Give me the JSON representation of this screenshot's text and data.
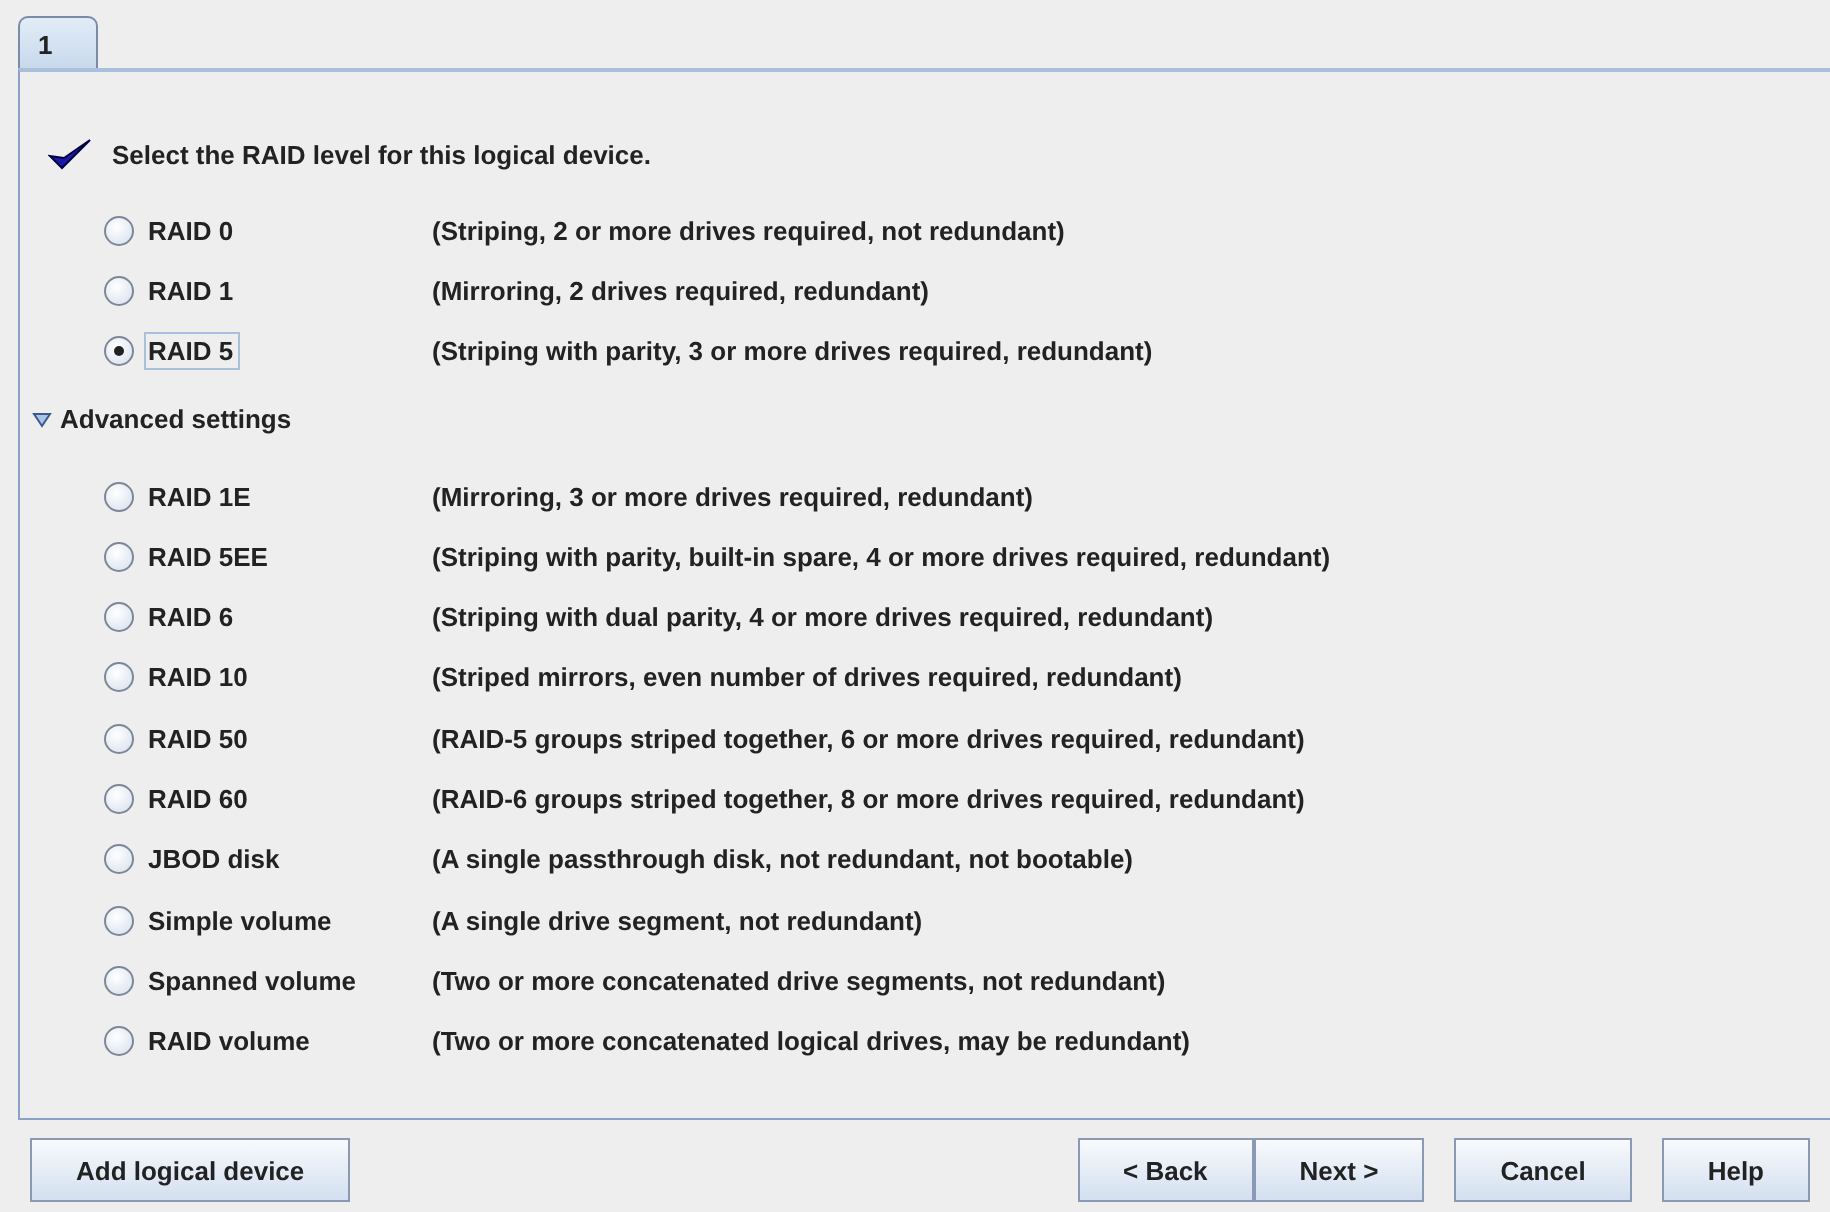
{
  "tabs": [
    {
      "label": "1",
      "selected": true
    }
  ],
  "heading": "Select the RAID level for this logical device.",
  "levels": [
    {
      "label": "RAID 0",
      "description": "(Striping, 2 or more drives required, not redundant)",
      "selected": false
    },
    {
      "label": "RAID 1",
      "description": "(Mirroring, 2 drives required, redundant)",
      "selected": false
    },
    {
      "label": "RAID 5",
      "description": "(Striping with parity, 3 or more drives required, redundant)",
      "selected": true
    }
  ],
  "advanced": {
    "label": "Advanced settings",
    "expanded": true,
    "levels": [
      {
        "label": "RAID 1E",
        "description": "(Mirroring, 3 or more drives required, redundant)",
        "selected": false
      },
      {
        "label": "RAID 5EE",
        "description": "(Striping with parity, built-in spare, 4 or more drives required, redundant)",
        "selected": false
      },
      {
        "label": "RAID 6",
        "description": "(Striping with dual parity, 4 or more drives required, redundant)",
        "selected": false
      },
      {
        "label": "RAID 10",
        "description": "(Striped mirrors, even number of drives required, redundant)",
        "selected": false
      },
      {
        "label": "RAID 50",
        "description": "(RAID-5 groups striped together, 6 or more drives required, redundant)",
        "selected": false
      },
      {
        "label": "RAID 60",
        "description": "(RAID-6 groups striped together, 8 or more drives required, redundant)",
        "selected": false
      },
      {
        "label": "JBOD disk",
        "description": "(A single passthrough disk, not redundant, not bootable)",
        "selected": false
      },
      {
        "label": "Simple volume",
        "description": "(A single drive segment, not redundant)",
        "selected": false
      },
      {
        "label": "Spanned volume",
        "description": "(Two or more concatenated drive segments, not redundant)",
        "selected": false
      },
      {
        "label": "RAID volume",
        "description": "(Two or more concatenated logical drives, may be redundant)",
        "selected": false
      }
    ]
  },
  "buttons": {
    "left": [
      "Add logical device"
    ],
    "right": [
      [
        "< Back",
        "Next >"
      ],
      [
        "Cancel"
      ],
      [
        "Help"
      ]
    ]
  }
}
